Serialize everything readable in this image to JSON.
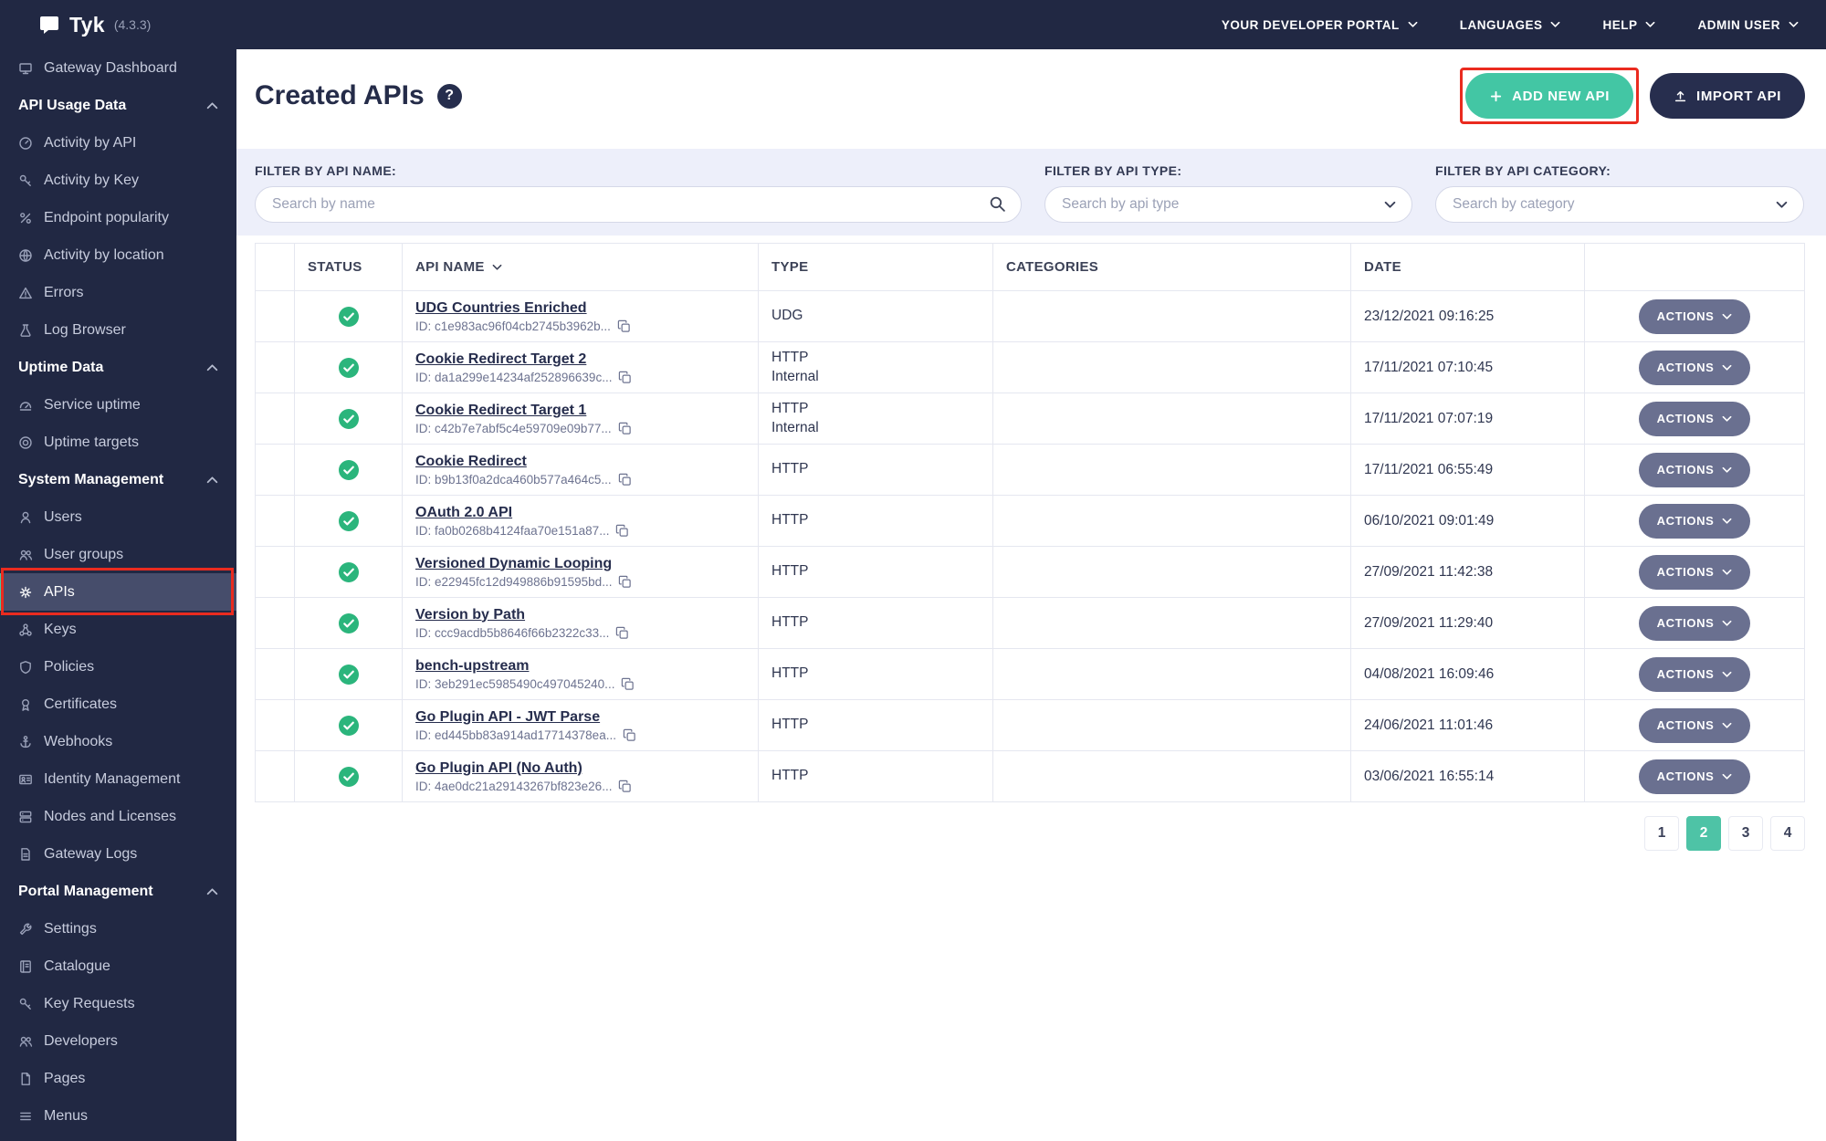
{
  "topbar": {
    "brand": "Tyk",
    "version": "(4.3.3)",
    "menu": [
      "YOUR DEVELOPER PORTAL",
      "LANGUAGES",
      "HELP",
      "ADMIN USER"
    ]
  },
  "sidebar": {
    "items": [
      {
        "label": "Gateway Dashboard",
        "kind": "item",
        "icon": "monitor-icon"
      },
      {
        "label": "API Usage Data",
        "kind": "section",
        "icon": "chevron-up-icon"
      },
      {
        "label": "Activity by API",
        "kind": "item",
        "icon": "gauge-icon"
      },
      {
        "label": "Activity by Key",
        "kind": "item",
        "icon": "key-icon"
      },
      {
        "label": "Endpoint popularity",
        "kind": "item",
        "icon": "percent-icon"
      },
      {
        "label": "Activity by location",
        "kind": "item",
        "icon": "globe-icon"
      },
      {
        "label": "Errors",
        "kind": "item",
        "icon": "alert-triangle-icon"
      },
      {
        "label": "Log Browser",
        "kind": "item",
        "icon": "flask-icon"
      },
      {
        "label": "Uptime Data",
        "kind": "section",
        "icon": "chevron-up-icon"
      },
      {
        "label": "Service uptime",
        "kind": "item",
        "icon": "half-gauge-icon"
      },
      {
        "label": "Uptime targets",
        "kind": "item",
        "icon": "target-icon"
      },
      {
        "label": "System Management",
        "kind": "section",
        "icon": "chevron-up-icon"
      },
      {
        "label": "Users",
        "kind": "item",
        "icon": "user-icon"
      },
      {
        "label": "User groups",
        "kind": "item",
        "icon": "user-group-icon"
      },
      {
        "label": "APIs",
        "kind": "item",
        "icon": "gear-icon",
        "active": true
      },
      {
        "label": "Keys",
        "kind": "item",
        "icon": "network-icon"
      },
      {
        "label": "Policies",
        "kind": "item",
        "icon": "shield-icon"
      },
      {
        "label": "Certificates",
        "kind": "item",
        "icon": "certificate-icon"
      },
      {
        "label": "Webhooks",
        "kind": "item",
        "icon": "anchor-icon"
      },
      {
        "label": "Identity Management",
        "kind": "item",
        "icon": "id-card-icon"
      },
      {
        "label": "Nodes and Licenses",
        "kind": "item",
        "icon": "server-icon"
      },
      {
        "label": "Gateway Logs",
        "kind": "item",
        "icon": "document-icon"
      },
      {
        "label": "Portal Management",
        "kind": "section",
        "icon": "chevron-up-icon"
      },
      {
        "label": "Settings",
        "kind": "item",
        "icon": "wrench-icon"
      },
      {
        "label": "Catalogue",
        "kind": "item",
        "icon": "book-icon"
      },
      {
        "label": "Key Requests",
        "kind": "item",
        "icon": "key-icon"
      },
      {
        "label": "Developers",
        "kind": "item",
        "icon": "user-group-icon"
      },
      {
        "label": "Pages",
        "kind": "item",
        "icon": "page-icon"
      },
      {
        "label": "Menus",
        "kind": "item",
        "icon": "menu-icon"
      }
    ]
  },
  "page": {
    "title": "Created APIs",
    "help_glyph": "?",
    "add_api_label": "ADD NEW API",
    "import_api_label": "IMPORT API"
  },
  "filters": {
    "name_label": "FILTER BY API NAME:",
    "name_placeholder": "Search by name",
    "type_label": "FILTER BY API TYPE:",
    "type_placeholder": "Search by api type",
    "category_label": "FILTER BY API CATEGORY:",
    "category_placeholder": "Search by category"
  },
  "table": {
    "headers": {
      "status": "STATUS",
      "name": "API NAME",
      "type": "TYPE",
      "categories": "CATEGORIES",
      "date": "DATE"
    },
    "actions_label": "ACTIONS",
    "rows": [
      {
        "status": "active",
        "name": "UDG Countries Enriched",
        "id": "ID: c1e983ac96f04cb2745b3962b...",
        "type": "UDG",
        "type_sub": "",
        "categories": "",
        "date": "23/12/2021 09:16:25"
      },
      {
        "status": "active",
        "name": "Cookie Redirect Target 2",
        "id": "ID: da1a299e14234af252896639c...",
        "type": "HTTP",
        "type_sub": "Internal",
        "categories": "",
        "date": "17/11/2021 07:10:45"
      },
      {
        "status": "active",
        "name": "Cookie Redirect Target 1",
        "id": "ID: c42b7e7abf5c4e59709e09b77...",
        "type": "HTTP",
        "type_sub": "Internal",
        "categories": "",
        "date": "17/11/2021 07:07:19"
      },
      {
        "status": "active",
        "name": "Cookie Redirect",
        "id": "ID: b9b13f0a2dca460b577a464c5...",
        "type": "HTTP",
        "type_sub": "",
        "categories": "",
        "date": "17/11/2021 06:55:49"
      },
      {
        "status": "active",
        "name": "OAuth 2.0 API",
        "id": "ID: fa0b0268b4124faa70e151a87...",
        "type": "HTTP",
        "type_sub": "",
        "categories": "",
        "date": "06/10/2021 09:01:49"
      },
      {
        "status": "active",
        "name": "Versioned Dynamic Looping",
        "id": "ID: e22945fc12d949886b91595bd...",
        "type": "HTTP",
        "type_sub": "",
        "categories": "",
        "date": "27/09/2021 11:42:38"
      },
      {
        "status": "active",
        "name": "Version by Path",
        "id": "ID: ccc9acdb5b8646f66b2322c33...",
        "type": "HTTP",
        "type_sub": "",
        "categories": "",
        "date": "27/09/2021 11:29:40"
      },
      {
        "status": "active",
        "name": "bench-upstream",
        "id": "ID: 3eb291ec5985490c497045240...",
        "type": "HTTP",
        "type_sub": "",
        "categories": "",
        "date": "04/08/2021 16:09:46"
      },
      {
        "status": "active",
        "name": "Go Plugin API - JWT Parse",
        "id": "ID: ed445bb83a914ad17714378ea...",
        "type": "HTTP",
        "type_sub": "",
        "categories": "",
        "date": "24/06/2021 11:01:46"
      },
      {
        "status": "active",
        "name": "Go Plugin API (No Auth)",
        "id": "ID: 4ae0dc21a29143267bf823e26...",
        "type": "HTTP",
        "type_sub": "",
        "categories": "",
        "date": "03/06/2021 16:55:14"
      }
    ]
  },
  "pagination": {
    "pages": [
      "1",
      "2",
      "3",
      "4"
    ],
    "active_page": "2"
  },
  "colors": {
    "navy": "#212843",
    "accent_teal": "#43c6a4",
    "status_green": "#2bb57c",
    "annotation_red": "#ea2b1f",
    "filter_band": "#edeffa",
    "actions_gray": "#6a7090"
  },
  "icons": {
    "help": "question-circle",
    "add": "plus",
    "import": "upload-arrow",
    "search": "magnifier",
    "copy": "overlapping-squares",
    "status_active": "check-circle",
    "sort": "chevron-down",
    "dropdown": "chevron-down",
    "section_collapse": "chevron-up"
  }
}
